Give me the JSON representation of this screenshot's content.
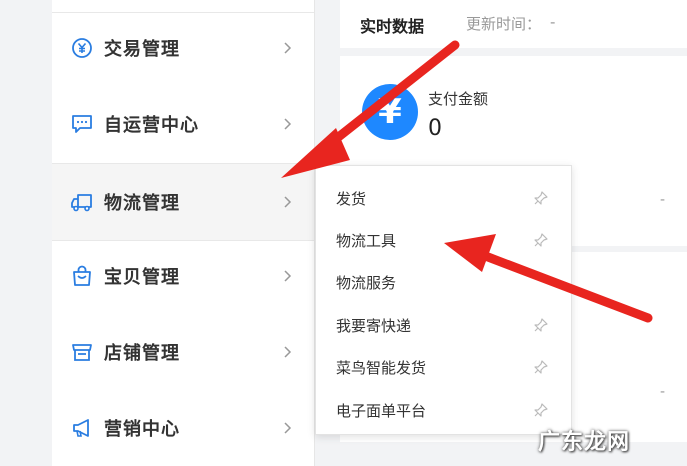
{
  "sidebar": {
    "items": [
      {
        "label": "交易管理",
        "icon": "yen-circle-icon"
      },
      {
        "label": "自运营中心",
        "icon": "chat-bubble-icon"
      },
      {
        "label": "物流管理",
        "icon": "truck-icon"
      },
      {
        "label": "宝贝管理",
        "icon": "shopping-bag-icon"
      },
      {
        "label": "店铺管理",
        "icon": "storefront-icon"
      },
      {
        "label": "营销中心",
        "icon": "megaphone-icon"
      }
    ],
    "active_index": 2
  },
  "header": {
    "tab_label": "实时数据",
    "update_label": "更新时间：",
    "update_value": "-"
  },
  "card": {
    "icon_symbol": "¥",
    "title": "支付金额",
    "value": "0",
    "trend": "-",
    "trend2": "-"
  },
  "submenu": {
    "items": [
      {
        "label": "发货",
        "pinned": true
      },
      {
        "label": "物流工具",
        "pinned": true
      },
      {
        "label": "物流服务",
        "pinned": false
      },
      {
        "label": "我要寄快递",
        "pinned": true
      },
      {
        "label": "菜鸟智能发货",
        "pinned": true
      },
      {
        "label": "电子面单平台",
        "pinned": true
      }
    ]
  },
  "watermark": "广东龙网",
  "colors": {
    "accent_blue": "#1e88ff",
    "arrow_red": "#e8251f",
    "icon_blue": "#2a7de1"
  }
}
